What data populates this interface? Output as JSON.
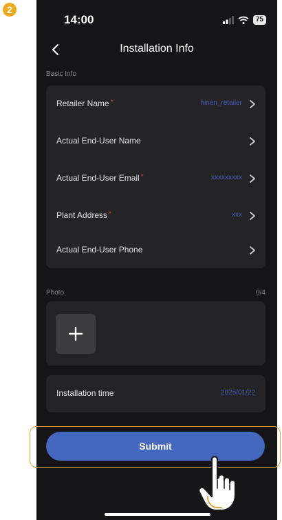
{
  "step_badge": "2",
  "status_bar": {
    "time": "14:00",
    "battery": "75"
  },
  "nav": {
    "title": "Installation Info"
  },
  "basic_info": {
    "label": "Basic Info",
    "rows": [
      {
        "label": "Retailer Name",
        "required": "*",
        "value": "hinen_retailer"
      },
      {
        "label": "Actual End-User Name",
        "required": "",
        "value": ""
      },
      {
        "label": "Actual End-User Email",
        "required": "*",
        "value": "xxxxxxxxx"
      },
      {
        "label": "Plant Address",
        "required": "*",
        "value": "xxx"
      },
      {
        "label": "Actual End-User Phone",
        "required": "",
        "value": ""
      }
    ]
  },
  "photo": {
    "label": "Photo",
    "count": "0/4"
  },
  "installation": {
    "label": "Installation time",
    "value": "2025/01/22"
  },
  "submit_label": "Submit",
  "colors": {
    "background": "#151517",
    "card": "#242426",
    "accent": "#4468bd",
    "required": "#e53b3b",
    "highlight": "#e2a53b"
  },
  "icons": [
    "back-icon",
    "chevron-right-icon",
    "plus-icon",
    "signal-icon",
    "wifi-icon",
    "battery-icon",
    "hand-pointer-icon"
  ]
}
